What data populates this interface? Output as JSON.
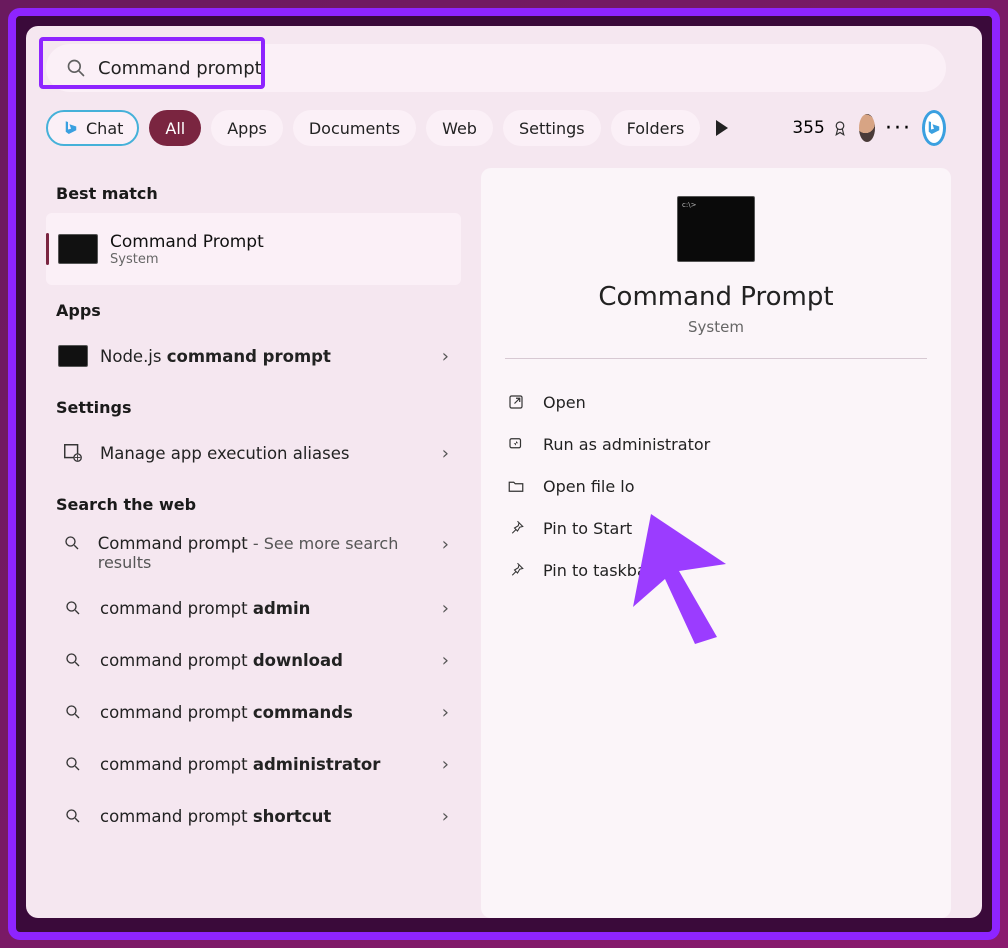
{
  "search": {
    "value": "Command prompt"
  },
  "filters": {
    "chat": "Chat",
    "all": "All",
    "apps": "Apps",
    "documents": "Documents",
    "web": "Web",
    "settings": "Settings",
    "folders": "Folders"
  },
  "rewards": {
    "points": "355"
  },
  "left": {
    "best_match_header": "Best match",
    "best_match": {
      "title": "Command Prompt",
      "subtitle": "System"
    },
    "apps_header": "Apps",
    "apps": [
      {
        "prefix": "Node.js ",
        "bold": "command prompt"
      }
    ],
    "settings_header": "Settings",
    "settings": [
      {
        "label": "Manage app execution aliases"
      }
    ],
    "search_web_header": "Search the web",
    "web": [
      {
        "prefix": "Command prompt",
        "suffix": " - See more search results"
      },
      {
        "prefix": "command prompt ",
        "bold": "admin"
      },
      {
        "prefix": "command prompt ",
        "bold": "download"
      },
      {
        "prefix": "command prompt ",
        "bold": "commands"
      },
      {
        "prefix": "command prompt ",
        "bold": "administrator"
      },
      {
        "prefix": "command prompt ",
        "bold": "shortcut"
      }
    ]
  },
  "preview": {
    "title": "Command Prompt",
    "subtitle": "System",
    "actions": {
      "open": "Open",
      "run_admin": "Run as administrator",
      "open_file_loc": "Open file lo",
      "pin_start": "Pin to Start",
      "pin_taskbar": "Pin to taskbar"
    }
  }
}
